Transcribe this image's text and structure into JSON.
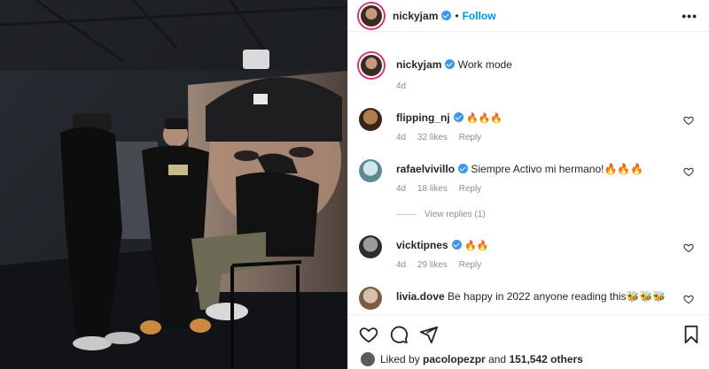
{
  "post": {
    "username": "nickyjam",
    "follow_label": "Follow",
    "dot": "•",
    "more_label": "•••"
  },
  "caption": {
    "username": "nickyjam",
    "text": "Work mode",
    "time": "4d"
  },
  "comments": [
    {
      "username": "flipping_nj",
      "text": "🔥🔥🔥",
      "time": "4d",
      "likes": "32 likes",
      "reply": "Reply"
    },
    {
      "username": "rafaelvivillo",
      "text": "Siempre Activo mi hermano!🔥🔥🔥",
      "time": "4d",
      "likes": "18 likes",
      "reply": "Reply",
      "view_replies": "View replies (1)"
    },
    {
      "username": "vicktipnes",
      "text": "🔥🔥",
      "time": "4d",
      "likes": "29 likes",
      "reply": "Reply"
    },
    {
      "username": "livia.dove",
      "text": "Be happy in 2022 anyone reading this🐝🐝🐝"
    }
  ],
  "liked_by": {
    "prefix": "Liked by",
    "user": "pacolopezpr",
    "and": "and",
    "others": "151,542 others"
  },
  "colors": {
    "accent": "#0095f6",
    "verified": "#3897f0",
    "muted": "#8e8e8e"
  },
  "icons": [
    "heart-icon",
    "comment-icon",
    "share-icon",
    "bookmark-icon",
    "more-icon"
  ]
}
